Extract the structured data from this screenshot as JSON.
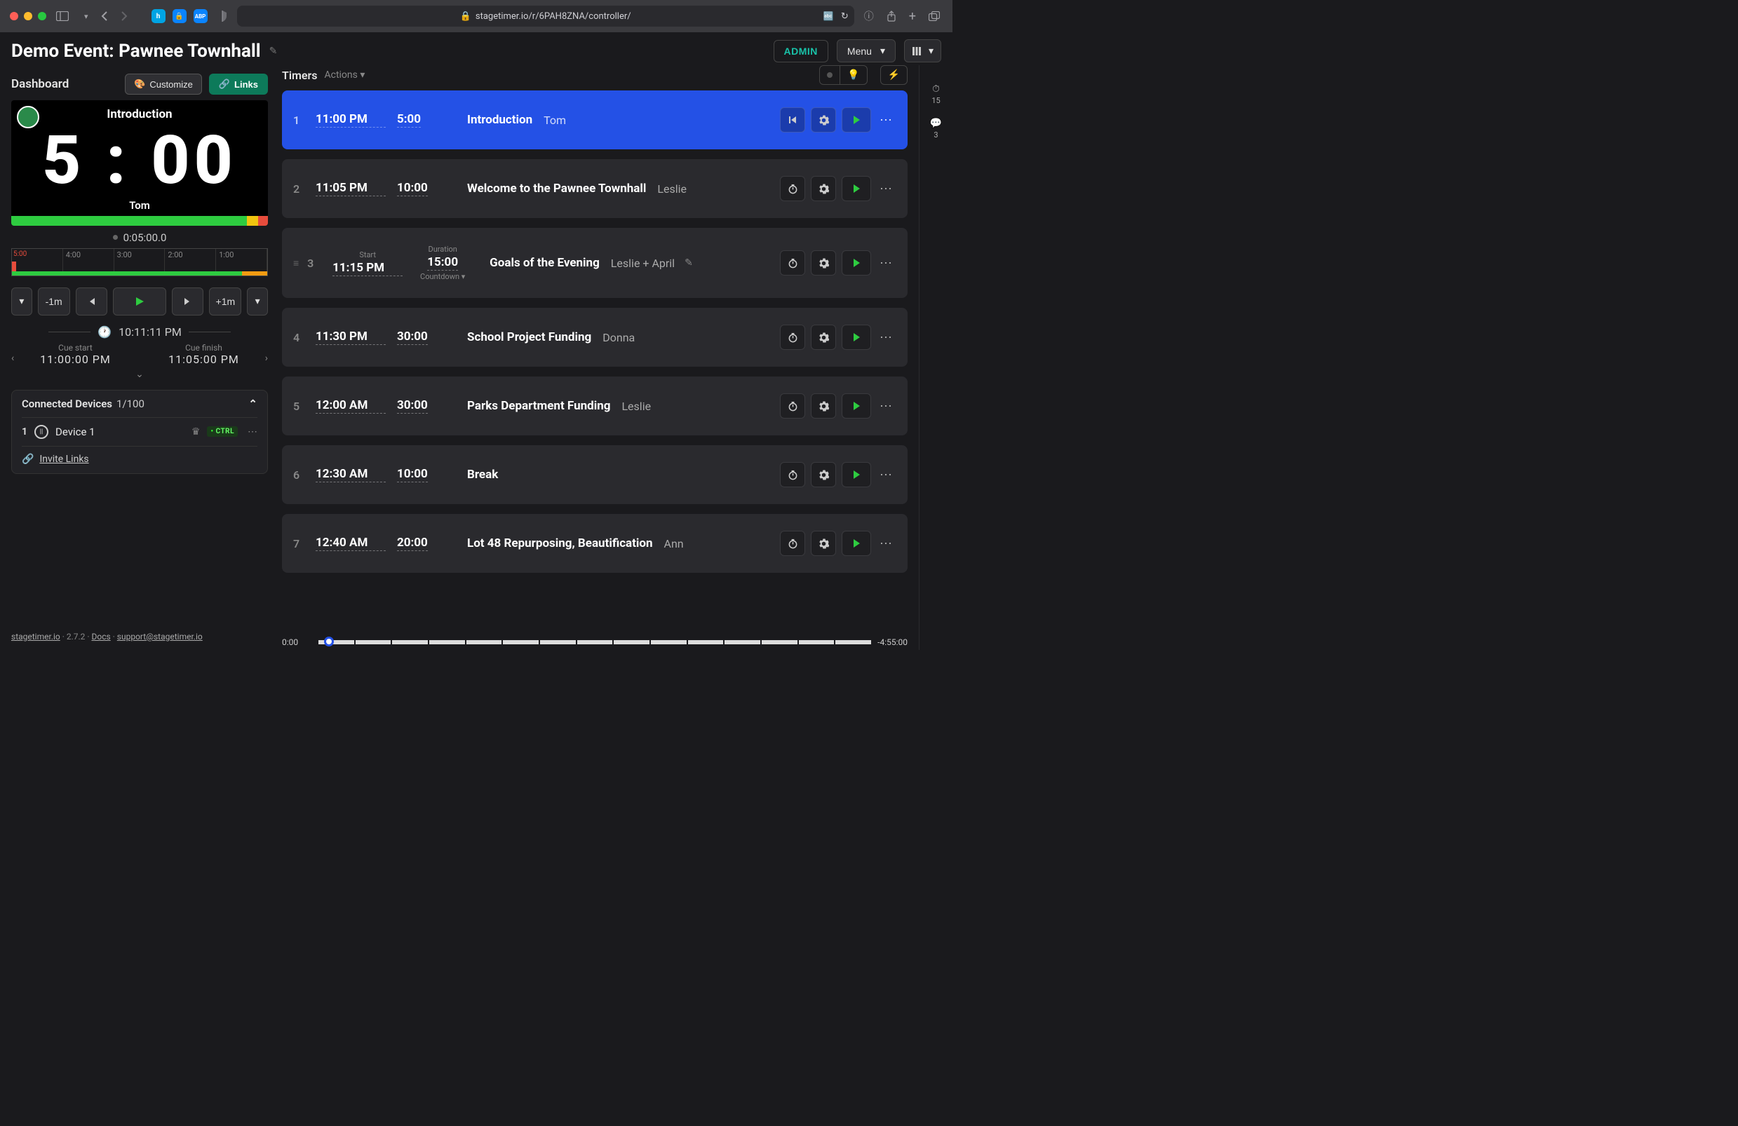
{
  "browser": {
    "url": "stagetimer.io/r/6PAH8ZNA/controller/"
  },
  "header": {
    "event_title": "Demo Event: Pawnee Townhall",
    "admin": "ADMIN",
    "menu": "Menu"
  },
  "dashboard": {
    "title": "Dashboard",
    "customize": "Customize",
    "links": "Links"
  },
  "preview": {
    "cue_title": "Introduction",
    "time": "5 : 00",
    "speaker": "Tom",
    "elapsed": "0:05:00.0",
    "ticks": [
      "5:00",
      "4:00",
      "3:00",
      "2:00",
      "1:00"
    ]
  },
  "transport": {
    "minus": "-1m",
    "plus": "+1m"
  },
  "clock": {
    "now": "10:11:11  PM",
    "cue_start_lbl": "Cue start",
    "cue_start": "11:00:00  PM",
    "cue_finish_lbl": "Cue finish",
    "cue_finish": "11:05:00  PM"
  },
  "devices": {
    "title": "Connected Devices",
    "count": "1/100",
    "list": [
      {
        "num": "1",
        "name": "Device 1",
        "badge": "CTRL"
      }
    ],
    "invite": "Invite Links"
  },
  "footer": {
    "site": "stagetimer.io",
    "version": "2.7.2",
    "docs": "Docs",
    "support": "support@stagetimer.io"
  },
  "timers_head": {
    "title": "Timers",
    "actions": "Actions"
  },
  "timers": [
    {
      "idx": "1",
      "start": "11:00 PM",
      "dur": "5:00",
      "title": "Introduction",
      "speaker": "Tom",
      "active": true,
      "first_icon": "reset"
    },
    {
      "idx": "2",
      "start": "11:05 PM",
      "dur": "10:00",
      "title": "Welcome to the Pawnee Townhall",
      "speaker": "Leslie"
    },
    {
      "idx": "3",
      "start": "11:15 PM",
      "dur": "15:00",
      "title": "Goals of the Evening",
      "speaker": "Leslie + April",
      "expanded": true,
      "start_lbl": "Start",
      "dur_lbl": "Duration",
      "mode": "Countdown"
    },
    {
      "idx": "4",
      "start": "11:30 PM",
      "dur": "30:00",
      "title": "School Project Funding",
      "speaker": "Donna"
    },
    {
      "idx": "5",
      "start": "12:00 AM",
      "dur": "30:00",
      "title": "Parks Department Funding",
      "speaker": "Leslie"
    },
    {
      "idx": "6",
      "start": "12:30 AM",
      "dur": "10:00",
      "title": "Break",
      "speaker": ""
    },
    {
      "idx": "7",
      "start": "12:40 AM",
      "dur": "20:00",
      "title": "Lot 48 Repurposing, Beautification",
      "speaker": "Ann"
    }
  ],
  "bottom": {
    "left": "0:00",
    "right": "-4:55:00"
  },
  "rail": {
    "timers_count": "15",
    "msgs_count": "3"
  }
}
